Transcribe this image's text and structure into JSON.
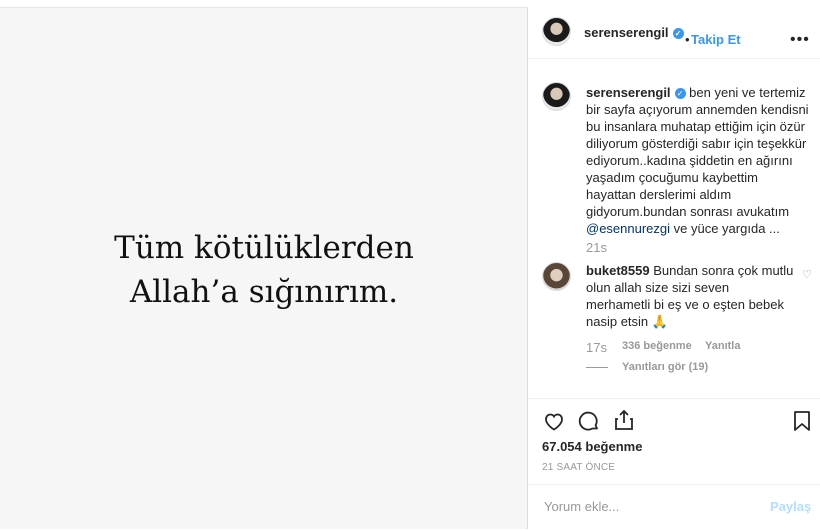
{
  "image": {
    "line1": "Tüm kötülüklerden",
    "line2": "Allah’a sığınırım."
  },
  "header": {
    "username": "serenserengil",
    "dot": "•",
    "follow_label": "Takip Et",
    "more_label": "•••"
  },
  "caption": {
    "username": "serenserengil",
    "text_before": " ben yeni ve tertemiz bir sayfa açıyorum annemden kendisni bu insanlara muhatap ettiğim için özür diliyorum gösterdiği sabır için teşekkür ediyorum..kadına şiddetin en ağırını yaşadım çocuğumu kaybettim hayattan derslerimi aldım gidyorum.bundan sonrası avukatım ",
    "mention": "@esennurezgi",
    "text_after": " ve yüce yargıda ...",
    "time": "21s"
  },
  "comment": {
    "username": "buket8559",
    "text": " Bundan sonra çok mutlu olun allah size sizi seven merhametli bi eş ve o eşten bebek nasip etsin 🙏",
    "time": "17s",
    "likes": "336 beğenme",
    "reply_label": "Yanıtla",
    "view_replies": "Yanıtları gör (19)"
  },
  "actions": {
    "likes": "67.054 beğenme",
    "date": "21 SAAT ÖNCE"
  },
  "comment_box": {
    "placeholder": "Yorum ekle...",
    "post_label": "Paylaş"
  }
}
